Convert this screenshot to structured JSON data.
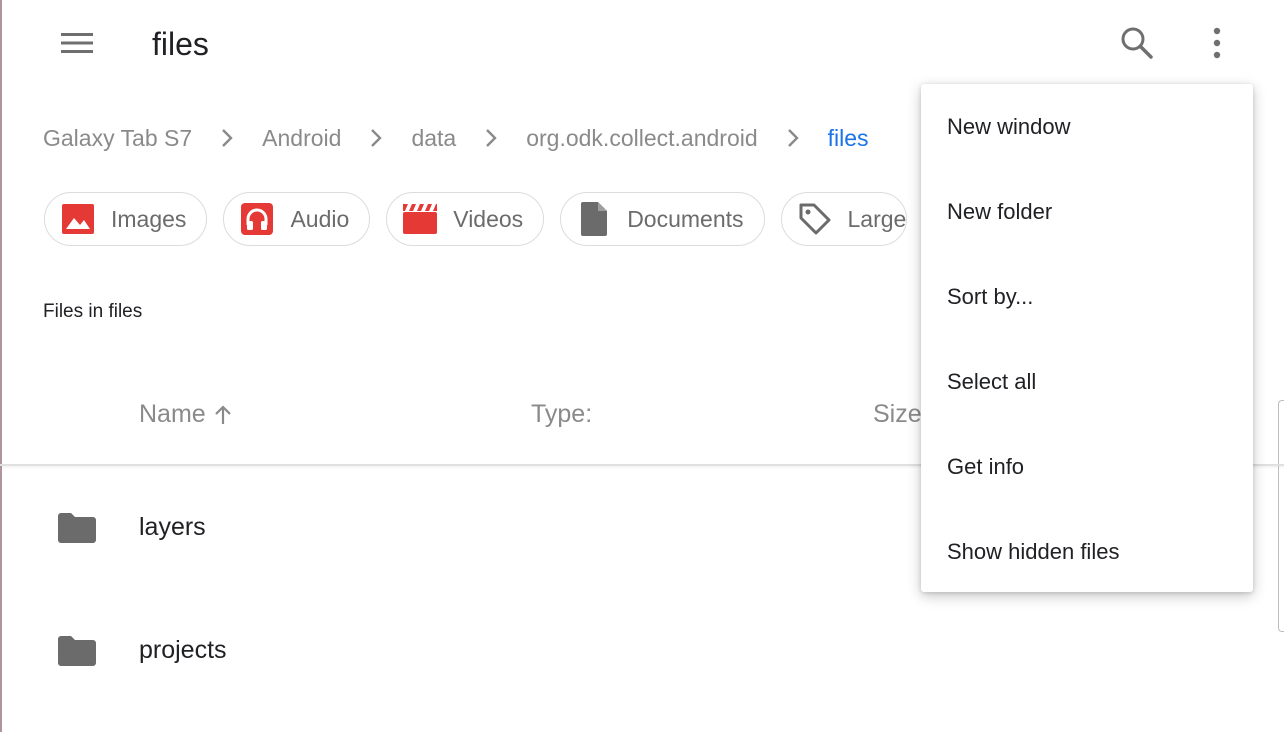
{
  "app": {
    "title": "files"
  },
  "toolbar": {
    "menu_icon": "hamburger-menu-icon",
    "search_icon": "search-icon",
    "more_icon": "more-vert-icon"
  },
  "breadcrumb": {
    "items": [
      "Galaxy Tab S7",
      "Android",
      "data",
      "org.odk.collect.android",
      "files"
    ],
    "active_color": "#1a73e8"
  },
  "chips": [
    {
      "label": "Images",
      "icon": "image-icon",
      "color": "#e53935"
    },
    {
      "label": "Audio",
      "icon": "headphones-icon",
      "color": "#e53935"
    },
    {
      "label": "Videos",
      "icon": "video-clapper-icon",
      "color": "#e53935"
    },
    {
      "label": "Documents",
      "icon": "document-icon",
      "color": "#6b6b6b"
    },
    {
      "label": "Large",
      "icon": "tag-icon",
      "color": "#6b6b6b"
    }
  ],
  "section": {
    "title": "Files in files"
  },
  "columns": {
    "name": "Name",
    "type": "Type:",
    "size": "Size"
  },
  "files": [
    {
      "name": "layers",
      "icon": "folder-icon"
    },
    {
      "name": "projects",
      "icon": "folder-icon"
    }
  ],
  "overflow_menu": {
    "items": [
      "New window",
      "New folder",
      "Sort by...",
      "Select all",
      "Get info",
      "Show hidden files"
    ]
  }
}
